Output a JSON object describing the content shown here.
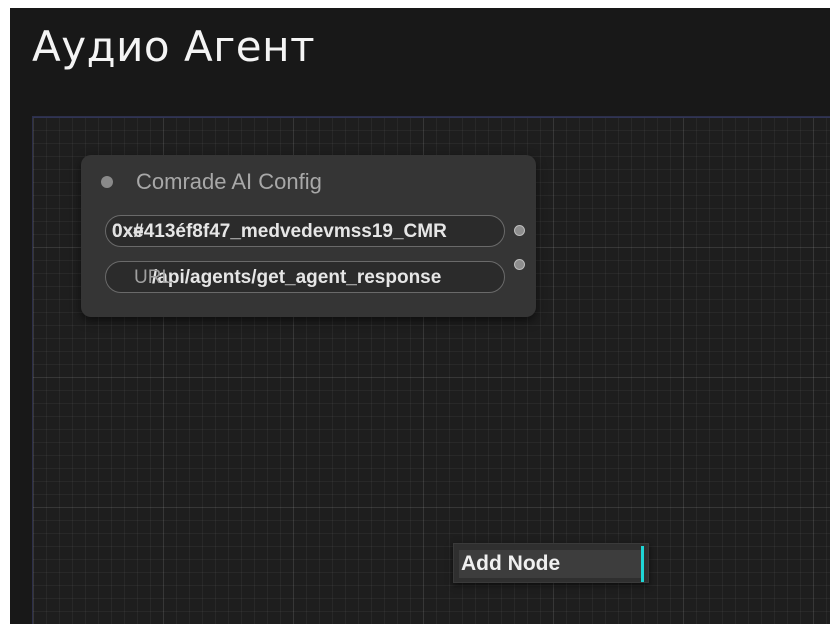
{
  "page": {
    "title": "Аудио Агент"
  },
  "node": {
    "title": "Comrade AI Config",
    "widgets": [
      {
        "label": "0xe",
        "value": "0x#413éf8f47_medvedevmss19_CMR"
      },
      {
        "label": "URL",
        "value": "/api/agents/get_agent_response"
      }
    ]
  },
  "context_menu": {
    "items": [
      {
        "label": "Add Node"
      }
    ]
  },
  "colors": {
    "accent": "#1fd6d6",
    "background": "#181818",
    "node": "#353535"
  }
}
